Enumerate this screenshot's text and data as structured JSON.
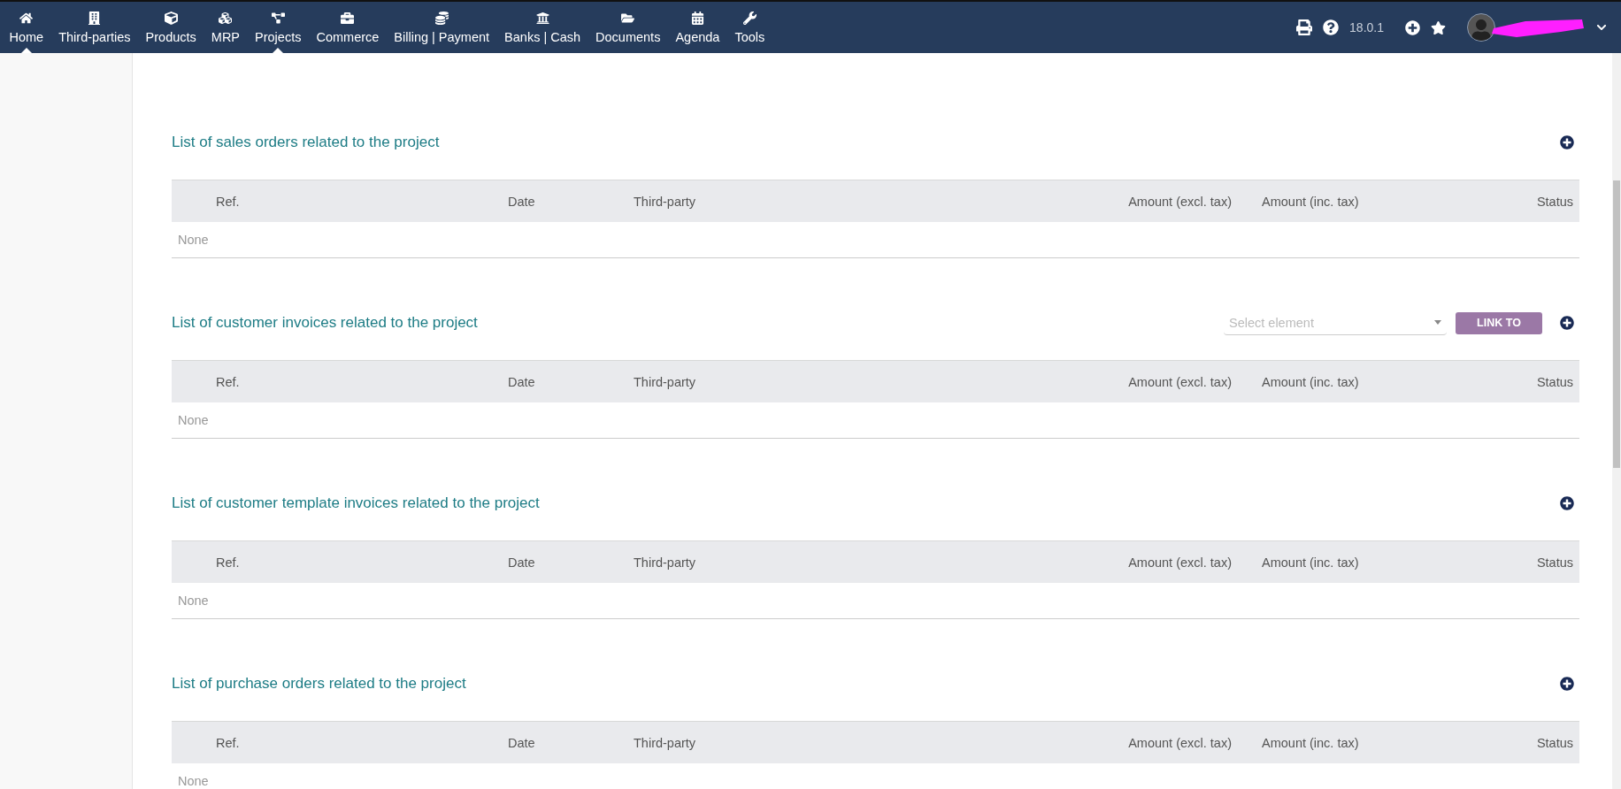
{
  "top_menu": [
    {
      "label": "Home",
      "selected": true
    },
    {
      "label": "Third-parties",
      "selected": false
    },
    {
      "label": "Products",
      "selected": false
    },
    {
      "label": "MRP",
      "selected": false
    },
    {
      "label": "Projects",
      "selected": true
    },
    {
      "label": "Commerce",
      "selected": false
    },
    {
      "label": "Billing | Payment",
      "selected": false
    },
    {
      "label": "Banks | Cash",
      "selected": false
    },
    {
      "label": "Documents",
      "selected": false
    },
    {
      "label": "Agenda",
      "selected": false
    },
    {
      "label": "Tools",
      "selected": false
    }
  ],
  "version": "18.0.1",
  "sections": [
    {
      "title": "List of sales orders related to the project",
      "columns": [
        "Ref.",
        "Date",
        "Third-party",
        "Amount (excl. tax)",
        "Amount (inc. tax)",
        "Status"
      ],
      "empty_text": "None"
    },
    {
      "title": "List of customer invoices related to the project",
      "select": {
        "placeholder": "Select element"
      },
      "link_button": "LINK TO",
      "columns": [
        "Ref.",
        "Date",
        "Third-party",
        "Amount (excl. tax)",
        "Amount (inc. tax)",
        "Status"
      ],
      "empty_text": "None"
    },
    {
      "title": "List of customer template invoices related to the project",
      "columns": [
        "Ref.",
        "Date",
        "Third-party",
        "Amount (excl. tax)",
        "Amount (inc. tax)",
        "Status"
      ],
      "empty_text": "None"
    },
    {
      "title": "List of purchase orders related to the project",
      "columns": [
        "Ref.",
        "Date",
        "Third-party",
        "Amount (excl. tax)",
        "Amount (inc. tax)",
        "Status"
      ],
      "empty_text": "None"
    }
  ]
}
